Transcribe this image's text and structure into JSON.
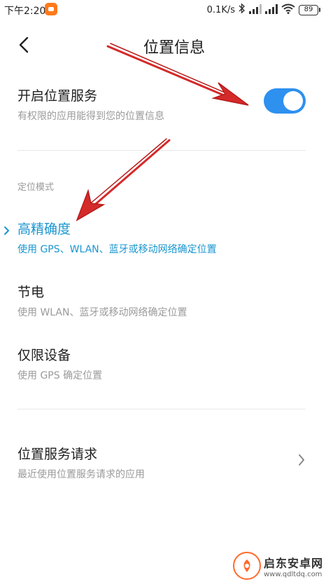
{
  "status_bar": {
    "time": "下午2:20",
    "net_speed": "0.1K/s",
    "battery": "89",
    "icons": [
      "app-notification-icon",
      "bluetooth-icon",
      "signal-icon",
      "signal-icon-2",
      "wifi-icon",
      "battery-icon"
    ]
  },
  "header": {
    "title": "位置信息",
    "back_icon": "chevron-left-icon"
  },
  "location_service": {
    "title": "开启位置服务",
    "subtitle": "有权限的应用能得到您的位置信息",
    "enabled": true
  },
  "mode_section": {
    "label": "定位模式",
    "items": [
      {
        "title": "高精确度",
        "subtitle": "使用 GPS、WLAN、蓝牙或移动网络确定位置",
        "selected": true
      },
      {
        "title": "节电",
        "subtitle": "使用 WLAN、蓝牙或移动网络确定位置",
        "selected": false
      },
      {
        "title": "仅限设备",
        "subtitle": "使用 GPS 确定位置",
        "selected": false
      }
    ]
  },
  "requests": {
    "title": "位置服务请求",
    "subtitle": "最近使用位置服务请求的应用"
  },
  "watermark": {
    "name": "启东安卓网",
    "url": "www.qdltdq.com"
  },
  "colors": {
    "accent": "#2e90ef",
    "selected_text": "#1a96d0",
    "annotation_arrow": "#d42a2a"
  }
}
